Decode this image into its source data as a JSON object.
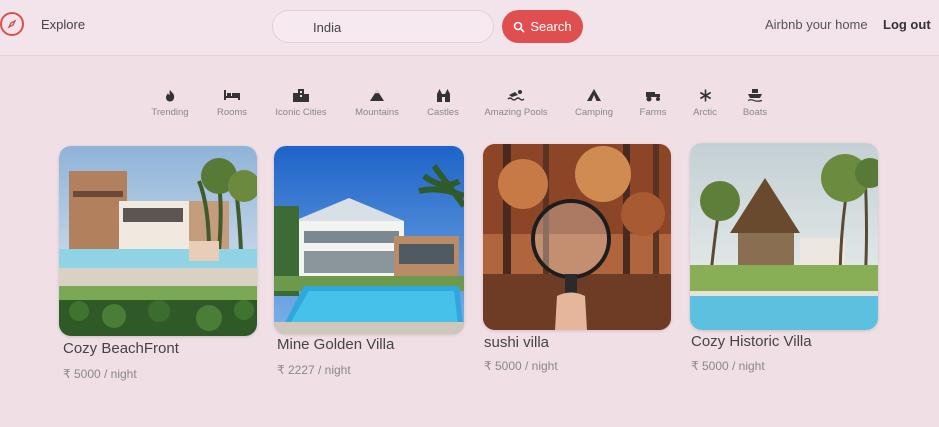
{
  "header": {
    "explore_label": "Explore",
    "search_value": "India",
    "search_button_label": "Search",
    "host_label": "Airbnb your home",
    "logout_label": "Log out"
  },
  "categories": [
    {
      "label": "Trending",
      "icon": "fire-icon"
    },
    {
      "label": "Rooms",
      "icon": "bed-icon"
    },
    {
      "label": "Iconic Cities",
      "icon": "city-icon"
    },
    {
      "label": "Mountains",
      "icon": "mountain-icon"
    },
    {
      "label": "Castles",
      "icon": "castle-icon"
    },
    {
      "label": "Amazing Pools",
      "icon": "swimmer-icon"
    },
    {
      "label": "Camping",
      "icon": "tent-icon"
    },
    {
      "label": "Farms",
      "icon": "tractor-icon"
    },
    {
      "label": "Arctic",
      "icon": "snowflake-icon"
    },
    {
      "label": "Boats",
      "icon": "ship-icon"
    }
  ],
  "listings": [
    {
      "title": "Cozy BeachFront",
      "price": "₹ 5000 / night"
    },
    {
      "title": "Mine Golden Villa",
      "price": "₹ 2227 / night"
    },
    {
      "title": "sushi villa",
      "price": "₹ 5000 / night"
    },
    {
      "title": "Cozy Historic Villa",
      "price": "₹ 5000 / night"
    }
  ],
  "colors": {
    "accent": "#df4f4f",
    "background": "#f1dfe6"
  }
}
